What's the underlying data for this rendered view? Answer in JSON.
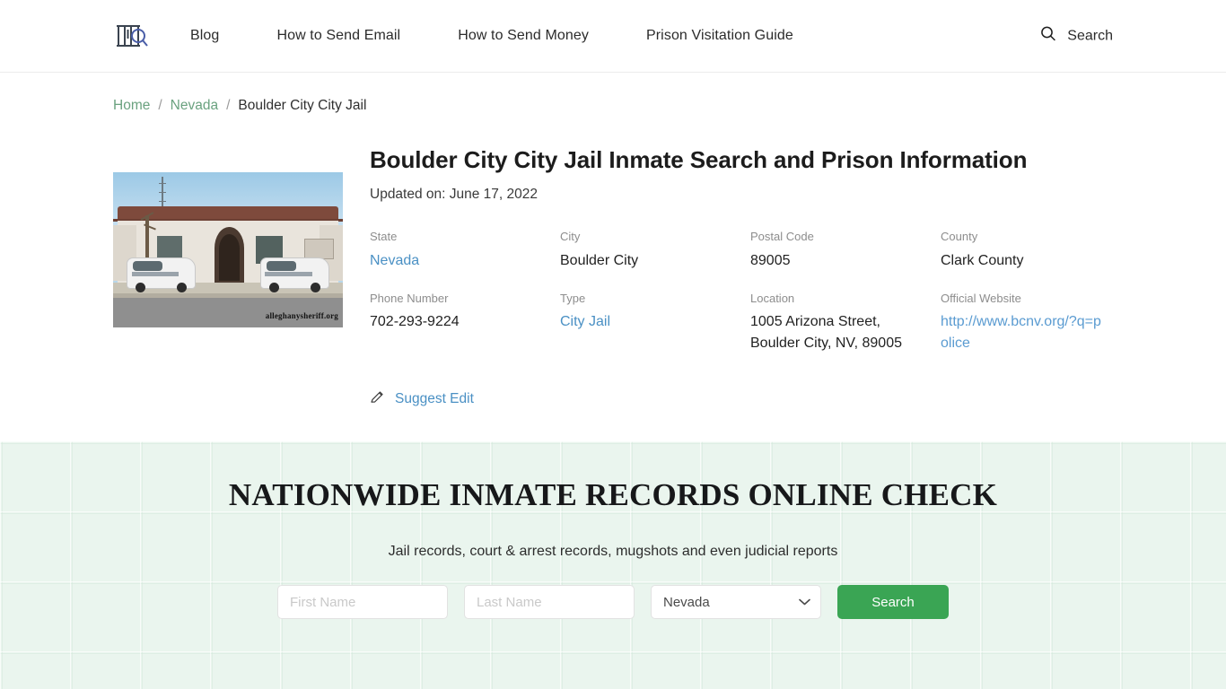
{
  "header": {
    "logo_icon": "prison-bars-magnifier-logo",
    "nav": [
      {
        "label": "Blog"
      },
      {
        "label": "How to Send Email"
      },
      {
        "label": "How to Send Money"
      },
      {
        "label": "Prison Visitation Guide"
      }
    ],
    "search": {
      "icon": "search-icon",
      "label": "Search"
    }
  },
  "breadcrumb": {
    "home": "Home",
    "state": "Nevada",
    "current": "Boulder City City Jail",
    "separator": "/"
  },
  "page": {
    "title": "Boulder City City Jail Inmate Search and Prison Information",
    "updated": "Updated on: June 17, 2022",
    "photo": {
      "alt": "Boulder City City Jail building with police vehicles",
      "watermark": "alleghanysheriff.org"
    },
    "info": [
      {
        "label": "State",
        "value": "Nevada",
        "link": true
      },
      {
        "label": "City",
        "value": "Boulder City",
        "link": false
      },
      {
        "label": "Postal Code",
        "value": "89005",
        "link": false
      },
      {
        "label": "County",
        "value": "Clark County",
        "link": false
      },
      {
        "label": "Phone Number",
        "value": "702-293-9224",
        "link": false
      },
      {
        "label": "Type",
        "value": "City Jail",
        "link": true
      },
      {
        "label": "Location",
        "value": "1005 Arizona Street, Boulder City, NV, 89005",
        "link": false
      },
      {
        "label": "Official Website",
        "value": "http://www.bcnv.org/?q=police",
        "link": true
      }
    ],
    "suggest_edit": {
      "icon": "pencil-edit-icon",
      "label": "Suggest Edit"
    }
  },
  "promo": {
    "title": "NATIONWIDE INMATE RECORDS ONLINE CHECK",
    "subtitle": "Jail records, court & arrest records, mugshots and even judicial reports",
    "form": {
      "first_name_placeholder": "First Name",
      "first_name_value": "",
      "last_name_placeholder": "Last Name",
      "last_name_value": "",
      "state_selected": "Nevada",
      "state_options": [
        "Nevada"
      ],
      "chevron_icon": "chevron-down-icon",
      "submit_label": "Search"
    }
  },
  "colors": {
    "accent_green": "#3aa554",
    "link_blue": "#4a90c4",
    "breadcrumb_green": "#6aa27f",
    "promo_background": "#eaf5ee"
  }
}
